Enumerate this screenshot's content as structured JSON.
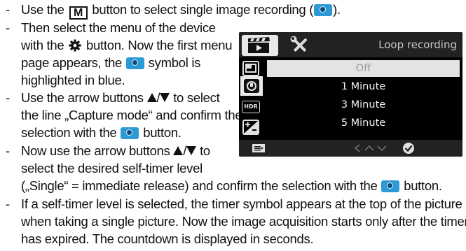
{
  "lines": [
    {
      "pre": "Use the ",
      "btn": "M",
      "mid": " button to select single image recording (",
      "post": ")."
    },
    {
      "a": "Then select the menu of the device"
    },
    {
      "a": "with the ",
      "b": " button. Now the first menu"
    },
    {
      "a": "page appears, the ",
      "b": " symbol is"
    },
    {
      "a": "highlighted in blue."
    },
    {
      "a": "Use the arrow buttons ",
      "sep": "/",
      "b": " to select"
    },
    {
      "a": "the line „Capture mode“ and confirm the"
    },
    {
      "a": "selection with the ",
      "b": " button."
    },
    {
      "a": "Now use the arrow buttons ",
      "sep": "/",
      "b": " to"
    },
    {
      "a": "select the desired self-timer level"
    },
    {
      "a": "(„Single“ = immediate release) and confirm the selection with the ",
      "b": " button."
    },
    {
      "a": "If a self-timer level is selected, the timer symbol appears at the top of the picture"
    },
    {
      "a": "when taking a single picture. Now the image acquisition starts only after the timer"
    },
    {
      "a": "has expired. The countdown is displayed in seconds."
    }
  ],
  "dash": "-",
  "device": {
    "title": "Loop recording",
    "options": [
      "Off",
      "1 Minute",
      "3 Minute",
      "5 Minute"
    ],
    "selected_index": 0,
    "hdr_label": "HDR"
  }
}
